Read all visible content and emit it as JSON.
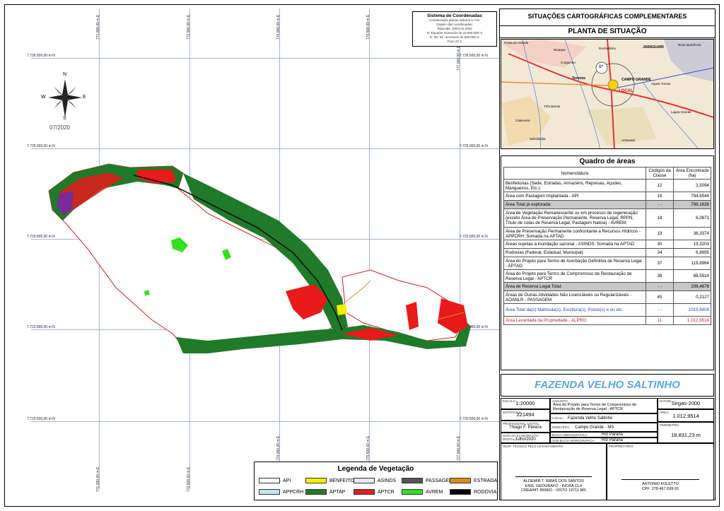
{
  "coord_system": {
    "title": "Sistema de Coordenadas",
    "lines": [
      "Coordenadas planas sistema U.T.M.",
      "Origem das coordenadas:",
      "Elipsoide: SIRGAS 2000",
      "N: Equador acrescido de 10.000.000 m",
      "E: MC 51° acrescido de 500.000 m",
      "Fuso 22 S"
    ]
  },
  "north": {
    "n": "N",
    "s": "S",
    "e": "E",
    "w": "W",
    "date": "07/2020"
  },
  "grid": {
    "e_labels": [
      "771.000,00 m E",
      "772.500,00 m E",
      "774.000,00 m E",
      "775.500,00 m E",
      "777.000,00 m E"
    ],
    "n_labels": [
      "7.726.500,00 m N",
      "7.725.000,00 m N",
      "7.723.500,00 m N",
      "7.722.000,00 m N",
      "7.720.500,00 m N"
    ]
  },
  "header": {
    "title": "SITUAÇÕES CARTOGRÁFICAS COMPLEMENTARES",
    "subtitle": "PLANTA DE SITUAÇÃO"
  },
  "inset_map": {
    "labels": [
      "Ponta do Grande",
      "Nioaque",
      "Rochedinho",
      "JARAGUARI",
      "Terenos",
      "CAMPO GRANDE",
      "LOCAL",
      "Sidrolândia",
      "Anhanduí",
      "Lagoa Grande",
      "Nova Querência",
      "Aquas Turvas",
      "Três Barras",
      "Cabeceira",
      "Corguinho"
    ],
    "badge": "1ª"
  },
  "quadro": {
    "title": "Quadro de áreas",
    "col_nomenclatura": "Nomenclatura",
    "col_codigos": "Códigos da Classe",
    "col_area": "Área Encontrada (ha)",
    "rows": [
      {
        "label": "Benfeitorias (Sede, Estradas, Armazéns, Represas, Açudes, Mangueiros, Etc.):",
        "code": "12",
        "area": "3,5094",
        "style": ""
      },
      {
        "label": "Área com Pastagem Implantada - API",
        "code": "16",
        "area": "794,6544",
        "style": ""
      },
      {
        "label": "Área Total já explorada:",
        "code": "- -",
        "area": "798,1638",
        "style": "gray"
      },
      {
        "label": "Área de Vegetação Remanescente ou em processo de regeneração (exceto Área de Preservação Permanente, Reserva Legal, RPPN, Título de cotas de Reserva Legal, Pastagem Nativa) - AVREM:",
        "code": "18",
        "area": "6,0871",
        "style": ""
      },
      {
        "label": "Área de Preservação Permanente confrontante a Recursos Hídricos - APPCRH: Somada na APTAD",
        "code": "19",
        "area": "36,3374",
        "style": ""
      },
      {
        "label": "Áreas sujeitas à inundação sazonal - ASINDS: Somada na APTAD",
        "code": "30",
        "area": "19,3203",
        "style": ""
      },
      {
        "label": "Rodovias (Federal, Estadual, Municipal)",
        "code": "34",
        "area": "6,8895",
        "style": ""
      },
      {
        "label": "Área do Projeto para Termo de Averbação Definitiva de Reserva Legal - APTAD:",
        "code": "37",
        "area": "119,8964",
        "style": ""
      },
      {
        "label": "Área do Projeto para Termo de Compromisso de Restauração de Reserva Legal - APTCR",
        "code": "38",
        "area": "88,5914",
        "style": ""
      },
      {
        "label": "Área de Reserva Legal Total:",
        "code": "- -",
        "area": "208,4878",
        "style": "gray"
      },
      {
        "label": "Áreas de Outras Atividades Não Licenciáveis ou Regularizáveis - AOANLR - PASSAGEM",
        "code": "45",
        "area": "0,2127",
        "style": ""
      },
      {
        "label": "Área Total da(s) Matrícula(s), Escritura(s), Posse(s) e ou etc.",
        "code": "- -",
        "area": "1019,8409",
        "style": "blue"
      },
      {
        "label": "Área Levantada da Propriedade - ALPRO:",
        "code": "11",
        "area": "1.012,9514",
        "style": "red"
      }
    ]
  },
  "farm": {
    "name": "FAZENDA VELHO SALTINHO"
  },
  "info": {
    "escala_lbl": "ESCALA:",
    "escala": "1:20000",
    "assunto_lbl": "ASSUNTO:",
    "assunto": "Área do Projeto para Termo de Compromisso de Restauração de Reserva Legal - APTCR",
    "datum_lbl": "DATUM:",
    "datum": "Sirgas-2000",
    "matricula_lbl": "MATRÍCULA:",
    "matricula": "221494",
    "area_lbl": "ÁREA:",
    "area": "1.012,9514",
    "local_lbl": "LOCAL:",
    "local": "Fazenda Velho Saltinho",
    "prof_lbl": "PROFISSIONAL DIGITAL:",
    "prof": "Thiago F. Pereira",
    "municipio_lbl": "MUNICÍPIO:",
    "municipio": "Campo Grande - MS",
    "perimetro_lbl": "PERÍMETRO:",
    "perimetro": "18.831,23 m",
    "data_lbl": "DATA DA ELABORAÇÃO DIGITAL:",
    "data": "Julho/2020",
    "bacia_lbl": "BACIA HIDROGRÁFICA:",
    "bacia": "Rio Parana",
    "subbacia_lbl": "SUB BACIA HIDROGRÁFICA:",
    "subbacia": "Rio Parana",
    "resp_lbl": "RESP. TÉCNICO PELO LEVANTAMENTO:",
    "prop_lbl": "PROPRIETÁRIO:",
    "resp_name": "ALDEMIR T. RIBAS DOS SANTOS",
    "resp_l2": "ENG. GEÓGRAFO - INCRA CL4",
    "resp_l3": "CREA/MT 8998/D - VISTO 19711-MS",
    "prop_name": "ANTONIO FOLETTO",
    "prop_l2": "CPF: 278.467.699-91"
  },
  "legend": {
    "title": "Legenda de Vegetação",
    "items": [
      {
        "label": "API",
        "color": "#ffffff"
      },
      {
        "label": "BENFEITORIA",
        "color": "#f5f000"
      },
      {
        "label": "ASINDS",
        "color": "#e8e8f8"
      },
      {
        "label": "PASSAGEM",
        "color": "#555555"
      },
      {
        "label": "ESTRADA",
        "color": "#e08a1e"
      },
      {
        "label": "APPCRH",
        "color": "#bfe6f2"
      },
      {
        "label": "APTAP",
        "color": "#1f7a2a"
      },
      {
        "label": "APTCR",
        "color": "#e81a1a"
      },
      {
        "label": "AVREM",
        "color": "#33e01f"
      },
      {
        "label": "RODOVIA",
        "color": "#000000"
      }
    ]
  }
}
